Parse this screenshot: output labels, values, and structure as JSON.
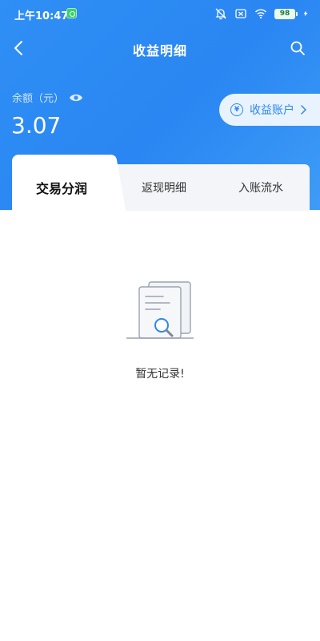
{
  "status_bar": {
    "time": "上午10:47",
    "battery": "98",
    "icons": [
      "app-notification-icon",
      "bell-muted-icon",
      "sim-off-icon",
      "wifi-icon",
      "battery-icon",
      "charging-icon"
    ]
  },
  "nav": {
    "title": "收益明细",
    "back_icon": "chevron-left-icon",
    "search_icon": "search-icon"
  },
  "balance": {
    "label": "余额（元）",
    "value": "3.07",
    "visibility_icon": "eye-icon"
  },
  "account_button": {
    "label": "收益账户",
    "icon": "yen-icon",
    "icon_glyph": "¥"
  },
  "tabs": [
    {
      "label": "交易分润",
      "active": true
    },
    {
      "label": "返现明细",
      "active": false
    },
    {
      "label": "入账流水",
      "active": false
    }
  ],
  "empty_state": {
    "text": "暂无记录!",
    "icon": "empty-document-search-icon"
  },
  "colors": {
    "primary": "#2d87ef",
    "header_gradient_start": "#2f8ff5",
    "header_gradient_end": "#3e9cf7",
    "account_button_bg": "#e8f3fe",
    "tab_bar_bg": "#f3f5f9"
  }
}
